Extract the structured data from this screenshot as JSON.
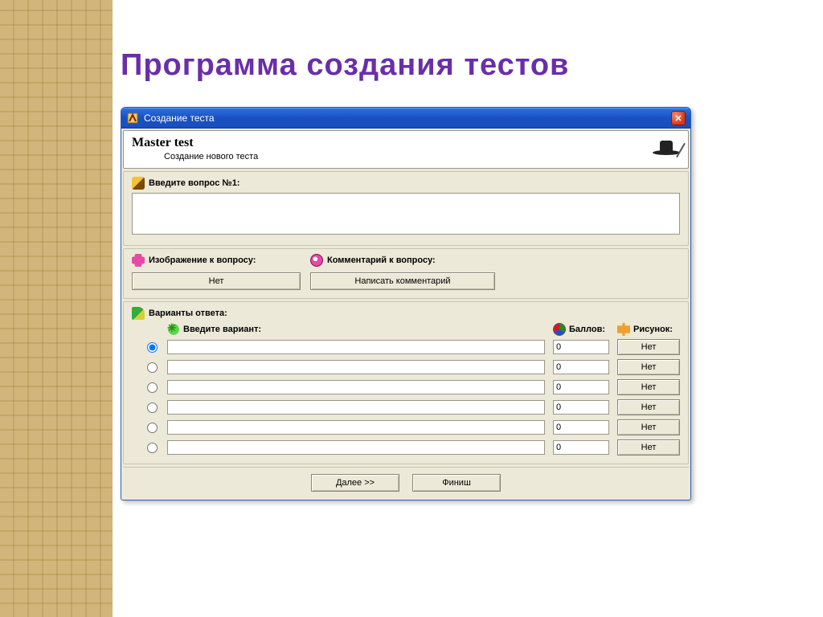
{
  "slide": {
    "title": "Программа создания тестов"
  },
  "window": {
    "title": "Создание теста"
  },
  "header": {
    "title": "Master test",
    "subtitle": "Создание нового теста"
  },
  "question": {
    "label": "Введите вопрос №1:",
    "value": "",
    "image_label": "Изображение к вопросу:",
    "image_button": "Нет",
    "comment_label": "Комментарий к вопросу:",
    "comment_button": "Написать комментарий"
  },
  "answers": {
    "section_label": "Варианты ответа:",
    "variant_header": "Введите вариант:",
    "score_header": "Баллов:",
    "image_header": "Рисунок:",
    "rows": [
      {
        "selected": true,
        "text": "",
        "score": "0",
        "image": "Нет"
      },
      {
        "selected": false,
        "text": "",
        "score": "0",
        "image": "Нет"
      },
      {
        "selected": false,
        "text": "",
        "score": "0",
        "image": "Нет"
      },
      {
        "selected": false,
        "text": "",
        "score": "0",
        "image": "Нет"
      },
      {
        "selected": false,
        "text": "",
        "score": "0",
        "image": "Нет"
      },
      {
        "selected": false,
        "text": "",
        "score": "0",
        "image": "Нет"
      }
    ]
  },
  "buttons": {
    "next": "Далее >>",
    "finish": "Финиш"
  }
}
